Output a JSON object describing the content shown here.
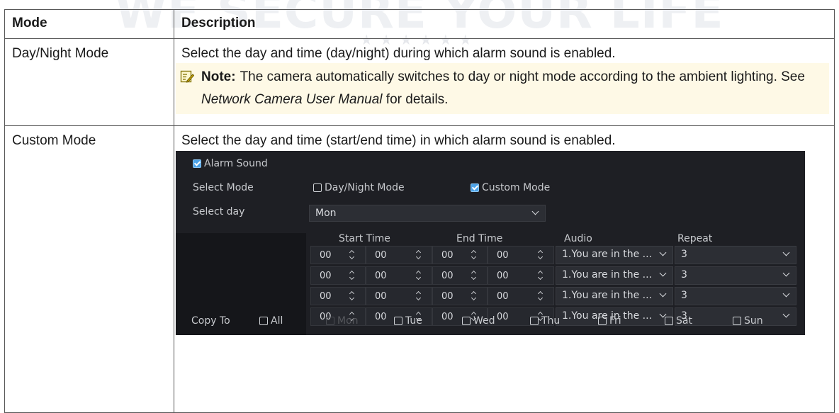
{
  "watermark": {
    "text": "WE SECURE YOUR LIFE",
    "stars": "★★★★★★"
  },
  "table": {
    "headers": {
      "mode": "Mode",
      "description": "Description"
    },
    "rows": [
      {
        "mode": "Day/Night Mode",
        "description": "Select the day and time (day/night) during which alarm sound is enabled.",
        "note": {
          "label": "Note:",
          "text_before": "The camera automatically switches to day or night mode according to the ambient lighting. See ",
          "text_italic": "Network Camera User Manual",
          "text_after": " for details."
        }
      },
      {
        "mode": "Custom Mode",
        "description": "Select the day and time (start/end time) in which alarm sound is enabled."
      }
    ]
  },
  "screenshot": {
    "alarm_sound_label": "Alarm Sound",
    "alarm_sound_checked": true,
    "select_mode_label": "Select Mode",
    "mode_options": [
      {
        "label": "Day/Night Mode",
        "checked": false
      },
      {
        "label": "Custom Mode",
        "checked": true
      }
    ],
    "select_day_label": "Select day",
    "select_day_value": "Mon",
    "columns": {
      "start_time": "Start Time",
      "end_time": "End Time",
      "audio": "Audio",
      "repeat": "Repeat"
    },
    "schedule_rows": [
      {
        "start_hh": "00",
        "start_mm": "00",
        "end_hh": "00",
        "end_mm": "00",
        "audio": "1.You are in the ...",
        "repeat": "3"
      },
      {
        "start_hh": "00",
        "start_mm": "00",
        "end_hh": "00",
        "end_mm": "00",
        "audio": "1.You are in the ...",
        "repeat": "3"
      },
      {
        "start_hh": "00",
        "start_mm": "00",
        "end_hh": "00",
        "end_mm": "00",
        "audio": "1.You are in the ...",
        "repeat": "3"
      },
      {
        "start_hh": "00",
        "start_mm": "00",
        "end_hh": "00",
        "end_mm": "00",
        "audio": "1.You are in the ...",
        "repeat": "3"
      }
    ],
    "copy_to_label": "Copy To",
    "copy_to_days": [
      {
        "label": "All",
        "disabled": false
      },
      {
        "label": "Mon",
        "disabled": true
      },
      {
        "label": "Tue",
        "disabled": false
      },
      {
        "label": "Wed",
        "disabled": false
      },
      {
        "label": "Thu",
        "disabled": false
      },
      {
        "label": "Fri",
        "disabled": false
      },
      {
        "label": "Sat",
        "disabled": false
      },
      {
        "label": "Sun",
        "disabled": false
      }
    ],
    "colors": {
      "bg": "#1e1f24",
      "checkbox_on": "#4da3e8",
      "note_bg": "#fef9e6"
    }
  }
}
